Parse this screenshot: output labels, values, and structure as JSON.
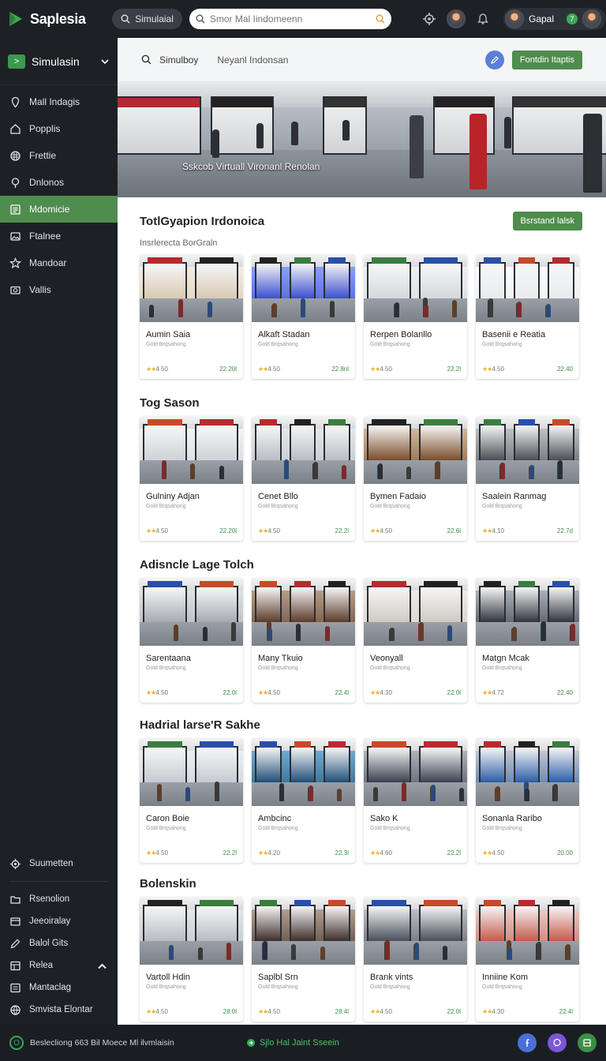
{
  "app": {
    "name": "Saplesia"
  },
  "topbar": {
    "pill_label": "Simulaial",
    "search_placeholder": "Smor Mal Iindomeenn",
    "user_name": "Gapal",
    "badge": "7"
  },
  "sidebar": {
    "header_label": "Simulasin",
    "items": [
      {
        "label": "Mall Indagis",
        "icon": "pin-icon"
      },
      {
        "label": "Popplis",
        "icon": "home-icon"
      },
      {
        "label": "Frettie",
        "icon": "grid-icon"
      },
      {
        "label": "Dnlonos",
        "icon": "location-icon"
      },
      {
        "label": "Mdomicie",
        "icon": "list-icon",
        "active": true
      },
      {
        "label": "Ftalnee",
        "icon": "image-icon"
      },
      {
        "label": "Mandoar",
        "icon": "star-icon"
      },
      {
        "label": "Vallis",
        "icon": "photo-icon"
      }
    ],
    "bottom_items": [
      {
        "label": "Suumetten",
        "icon": "settings-icon"
      },
      {
        "label": "Rsenolion",
        "icon": "folder-icon"
      },
      {
        "label": "Jeeoiralay",
        "icon": "box-icon"
      },
      {
        "label": "Balol Gits",
        "icon": "edit-icon"
      },
      {
        "label": "Relea",
        "icon": "table-icon"
      },
      {
        "label": "Mantaclag",
        "icon": "menu-icon"
      },
      {
        "label": "Smvista Elontar",
        "icon": "globe-icon"
      }
    ]
  },
  "subbar": {
    "search_label": "Simulboy",
    "secondary_label": "Neyanl Indonsan",
    "button_label": "Fontdin Itaptis"
  },
  "hero": {
    "caption": "Sskcob Virtuall Vironanl Renolan"
  },
  "sections": [
    {
      "title": "TotlGyapion Irdonoica",
      "subtitle": "Insrlerecta BorGraln",
      "action": "Bsrstand lalsk",
      "cards": [
        {
          "name": "Aumin Saia",
          "meta": "Gold Brqsahong",
          "rating": "4.50",
          "price": "22.20l"
        },
        {
          "name": "Alkaft Stadan",
          "meta": "Gold Brqsahong",
          "rating": "4.50",
          "price": "22.8nl"
        },
        {
          "name": "Rerpen Bolanllo",
          "meta": "Gold Brqsahong",
          "rating": "4.50",
          "price": "22.2l"
        },
        {
          "name": "Basenii e Reatia",
          "meta": "Gold Brqsahong",
          "rating": "4.50",
          "price": "22.40"
        }
      ]
    },
    {
      "title": "Tog Sason",
      "subtitle": "",
      "action": "",
      "cards": [
        {
          "name": "Gulniny Adjan",
          "meta": "Gold Brqsahong",
          "rating": "4.50",
          "price": "22.20l"
        },
        {
          "name": "Cenet Bllo",
          "meta": "Gold Brqsahong",
          "rating": "4.50",
          "price": "22.2l"
        },
        {
          "name": "Bymen Fadaio",
          "meta": "Gold Brqsahong",
          "rating": "4.50",
          "price": "22.6l"
        },
        {
          "name": "Saalein Ranmag",
          "meta": "Gold Brqsahong",
          "rating": "4.10",
          "price": "22.7d"
        }
      ]
    },
    {
      "title": "Adisncle Lage Tolch",
      "subtitle": "",
      "action": "",
      "cards": [
        {
          "name": "Sarentaana",
          "meta": "Gold Brqsahong",
          "rating": "4.50",
          "price": "22.0l"
        },
        {
          "name": "Many Tkuio",
          "meta": "Gold Brqsahong",
          "rating": "4.50",
          "price": "22.4l"
        },
        {
          "name": "Veonyall",
          "meta": "Gold Brqsahong",
          "rating": "4.30",
          "price": "22.0l"
        },
        {
          "name": "Matgn Mcak",
          "meta": "Gold Brqsahong",
          "rating": "4.72",
          "price": "22.40"
        }
      ]
    },
    {
      "title": "Hadrial larse'R Sakhe",
      "subtitle": "",
      "action": "",
      "cards": [
        {
          "name": "Caron Boie",
          "meta": "Gold Brqsahong",
          "rating": "4.50",
          "price": "22.2l"
        },
        {
          "name": "Ambcinc",
          "meta": "Gold Brqsahong",
          "rating": "4.20",
          "price": "22.3l"
        },
        {
          "name": "Sako K",
          "meta": "Gold Brqsahong",
          "rating": "4.60",
          "price": "22.2l"
        },
        {
          "name": "Sonanla Raribo",
          "meta": "Gold Brqsahong",
          "rating": "4.50",
          "price": "20.00"
        }
      ]
    },
    {
      "title": "Bolenskin",
      "subtitle": "",
      "action": "",
      "cards": [
        {
          "name": "Vartoll Hdin",
          "meta": "Gold Brqsahong",
          "rating": "4.50",
          "price": "28.0l"
        },
        {
          "name": "Saplbl Srn",
          "meta": "Gold Brqsahong",
          "rating": "4.50",
          "price": "28.4l"
        },
        {
          "name": "Brank vints",
          "meta": "Gold Brqsahong",
          "rating": "4.50",
          "price": "22.0l"
        },
        {
          "name": "Inniine Kom",
          "meta": "Gold Brqsahong",
          "rating": "4.30",
          "price": "22.4l"
        }
      ]
    }
  ],
  "footer": {
    "text": "Beslecliong 663 Bil Moece Ml ilvmlaisin",
    "link": "Sjlo Hal Jaint Sseein"
  },
  "colors": {
    "accent": "#4e8d4d",
    "sidebar_bg": "#1d2126",
    "link": "#4fbf66",
    "star": "#e5b323"
  }
}
